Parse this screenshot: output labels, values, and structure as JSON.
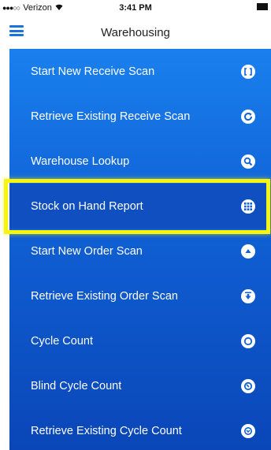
{
  "status_bar": {
    "carrier": "Verizon",
    "time": "3:41 PM"
  },
  "nav": {
    "title": "Warehousing"
  },
  "menu": {
    "items": [
      {
        "label": "Start New Receive Scan",
        "icon": "brackets-icon"
      },
      {
        "label": "Retrieve Existing Receive Scan",
        "icon": "refresh-icon"
      },
      {
        "label": "Warehouse Lookup",
        "icon": "search-icon"
      },
      {
        "label": "Stock on Hand Report",
        "icon": "grid-icon",
        "highlighted": true
      },
      {
        "label": "Start New Order Scan",
        "icon": "arrow-up-icon"
      },
      {
        "label": "Retrieve Existing Order Scan",
        "icon": "download-icon"
      },
      {
        "label": "Cycle Count",
        "icon": "ring-icon"
      },
      {
        "label": "Blind Cycle Count",
        "icon": "dial-icon"
      },
      {
        "label": "Retrieve Existing Cycle Count",
        "icon": "chevron-down-circle-icon"
      }
    ]
  },
  "colors": {
    "accent": "#1a73d8",
    "menu_top": "#1a80ee",
    "menu_bottom": "#0a46b8",
    "highlight": "#f5f50f"
  }
}
